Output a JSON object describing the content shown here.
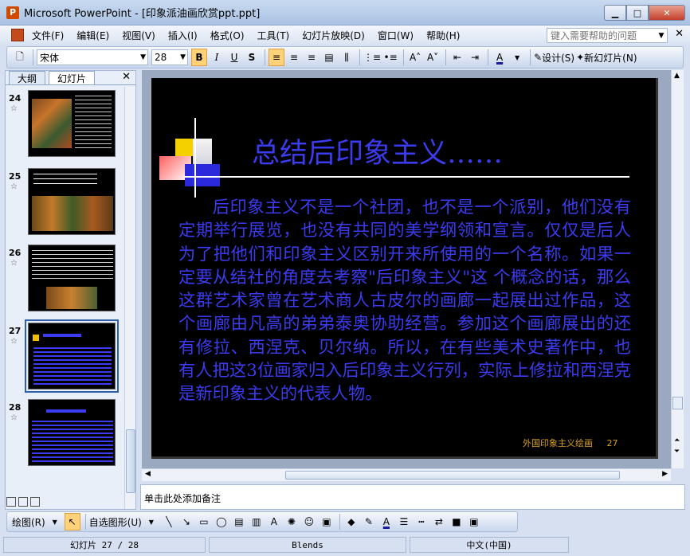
{
  "window": {
    "title": "Microsoft PowerPoint - [印象派油画欣赏ppt.ppt]",
    "app_icon": "P"
  },
  "menu": {
    "items": [
      "文件(F)",
      "编辑(E)",
      "视图(V)",
      "插入(I)",
      "格式(O)",
      "工具(T)",
      "幻灯片放映(D)",
      "窗口(W)",
      "帮助(H)"
    ],
    "help_placeholder": "键入需要帮助的问题"
  },
  "toolbar": {
    "font_name": "宋体",
    "font_size": "28",
    "bold": "B",
    "italic": "I",
    "underline": "U",
    "shadow": "S",
    "design_label": "设计(S)",
    "new_slide_label": "新幻灯片(N)"
  },
  "left_panel": {
    "tabs": [
      "大纲",
      "幻灯片"
    ],
    "active_tab": "幻灯片",
    "slides": [
      {
        "number": "24"
      },
      {
        "number": "25"
      },
      {
        "number": "26"
      },
      {
        "number": "27",
        "selected": true
      },
      {
        "number": "28"
      }
    ]
  },
  "slide": {
    "title": "总结后印象主义……",
    "body": "后印象主义不是一个社团，也不是一个派别，他们没有定期举行展览，也没有共同的美学纲领和宣言。仅仅是后人为了把他们和印象主义区别开来所使用的一个名称。如果一定要从结社的角度去考察\"后印象主义\"这 个概念的话，那么这群艺术家曾在艺术商人古皮尔的画廊一起展出过作品，这个画廊由凡高的弟弟泰奥协助经营。参加这个画廊展出的还有修拉、西涅克、贝尔纳。所以，在有些美术史著作中，也有人把这3位画家归入后印象主义行列，实际上修拉和西涅克是新印象主义的代表人物。",
    "footer_text": "外国印象主义绘画",
    "footer_page": "27",
    "title_color": "#3b3bf0",
    "body_color": "#3b3bf0"
  },
  "notes": {
    "placeholder": "单击此处添加备注"
  },
  "draw_toolbar": {
    "draw_label": "绘图(R)",
    "autoshape_label": "自选图形(U)"
  },
  "status": {
    "slide_info": "幻灯片 27 / 28",
    "design": "Blends",
    "language": "中文(中国)"
  }
}
